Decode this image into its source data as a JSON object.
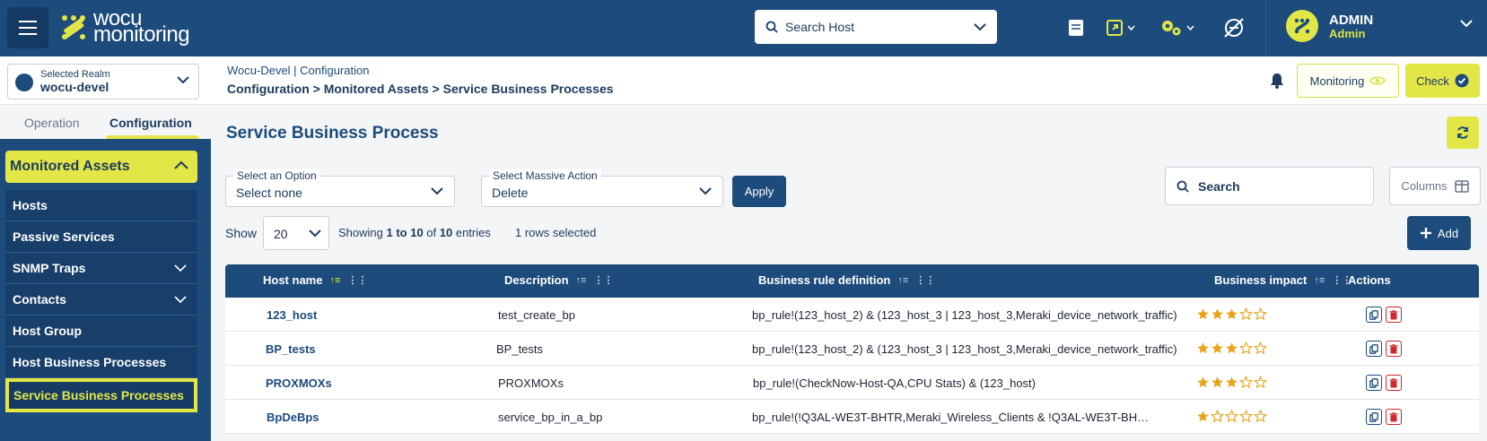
{
  "header": {
    "logo_line1": "wocu",
    "logo_line2": "monitoring",
    "search_host_label": "Search Host",
    "user_name": "ADMIN",
    "user_role": "Admin"
  },
  "realm": {
    "caption": "Selected Realm",
    "value": "wocu-devel"
  },
  "breadcrumb": {
    "top": "Wocu-Devel | Configuration",
    "path": "Configuration > Monitored Assets > Service Business Processes"
  },
  "actions_bar": {
    "monitoring_label": "Monitoring",
    "check_label": "Check"
  },
  "sidebar": {
    "tabs": [
      {
        "label": "Operation"
      },
      {
        "label": "Configuration"
      }
    ],
    "group_label": "Monitored Assets",
    "items": [
      {
        "label": "Hosts"
      },
      {
        "label": "Passive Services"
      },
      {
        "label": "SNMP Traps"
      },
      {
        "label": "Contacts"
      },
      {
        "label": "Host Group"
      },
      {
        "label": "Host Business Processes"
      },
      {
        "label": "Service Business Processes"
      }
    ]
  },
  "main": {
    "title": "Service Business Process",
    "option_select": {
      "caption": "Select an Option",
      "value": "Select none"
    },
    "massive_select": {
      "caption": "Select Massive Action",
      "value": "Delete"
    },
    "apply_label": "Apply",
    "search_label": "Search",
    "columns_label": "Columns",
    "show_label": "Show",
    "page_size": "20",
    "entries_prefix": "Showing ",
    "entries_from": "1",
    "entries_mid1": " to ",
    "entries_to": "10",
    "entries_mid2": " of ",
    "entries_total": "10",
    "entries_suffix": " entries",
    "rows_selected": "1 rows selected",
    "add_label": "Add"
  },
  "table": {
    "columns": [
      "Host name",
      "Description",
      "Business rule definition",
      "Business impact",
      "Actions"
    ],
    "rows": [
      {
        "host": "123_host",
        "description": "test_create_bp",
        "rule": "bp_rule!(123_host_2) & (123_host_3 | 123_host_3,Meraki_device_network_traffic)",
        "impact": 3
      },
      {
        "host": "BP_tests",
        "description": "BP_tests",
        "rule": "bp_rule!(123_host_2) & (123_host_3 | 123_host_3,Meraki_device_network_traffic)",
        "impact": 3
      },
      {
        "host": "PROXMOXs",
        "description": "PROXMOXs",
        "rule": "bp_rule!(CheckNow-Host-QA,CPU Stats) & (123_host)",
        "impact": 3
      },
      {
        "host": "BpDeBps",
        "description": "service_bp_in_a_bp",
        "rule": "bp_rule!(!Q3AL-WE3T-BHTR,Meraki_Wireless_Clients & !Q3AL-WE3T-BH…",
        "impact": 1
      }
    ]
  },
  "colors": {
    "primary": "#1c4b7c",
    "accent": "#e3e647",
    "star": "#e8a317",
    "danger": "#d0262d"
  }
}
